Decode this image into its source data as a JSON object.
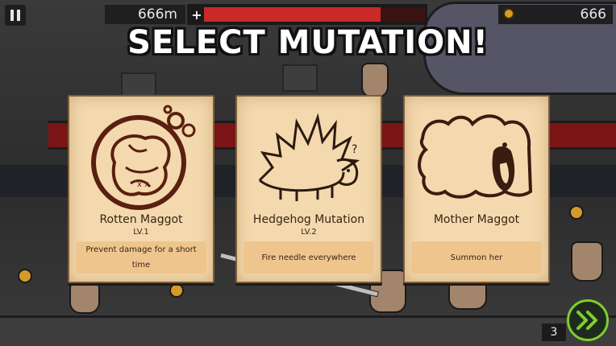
{
  "hud": {
    "distance": "666m",
    "coins": "666",
    "health_fraction": 0.8,
    "speed_count": "3"
  },
  "title": "SELECT MUTATION!",
  "cards": [
    {
      "name": "Rotten Maggot",
      "level": "LV.1",
      "description": "Prevent damage for a short time",
      "icon": "curled-maggot-bubble-icon"
    },
    {
      "name": "Hedgehog Mutation",
      "level": "LV.2",
      "description": "Fire needle everywhere",
      "icon": "hedgehog-icon"
    },
    {
      "name": "Mother Maggot",
      "level": "",
      "description": "Summon her",
      "icon": "mother-maggot-icon"
    }
  ],
  "colors": {
    "health": "#c92929",
    "accent": "#7fcf2b",
    "card": "#f3d9ad"
  }
}
